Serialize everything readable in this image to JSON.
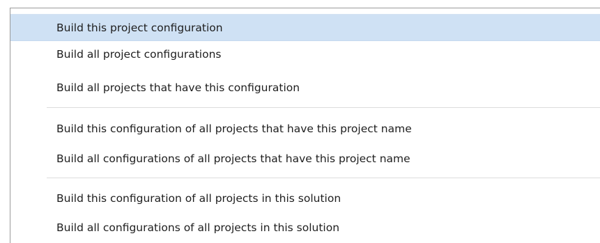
{
  "menu": {
    "groups": [
      {
        "items": [
          {
            "label": "Build this project configuration",
            "selected": true
          },
          {
            "label": "Build all project configurations",
            "selected": false
          },
          {
            "label": "Build all projects that have this configuration",
            "selected": false
          }
        ]
      },
      {
        "items": [
          {
            "label": "Build this configuration of all projects that have this project name",
            "selected": false
          },
          {
            "label": "Build all configurations of all projects that have this project name",
            "selected": false
          }
        ]
      },
      {
        "items": [
          {
            "label": "Build this configuration of all projects in this solution",
            "selected": false
          },
          {
            "label": "Build all configurations of all projects in this solution",
            "selected": false
          }
        ]
      }
    ]
  },
  "colors": {
    "selected_background": "#cfe1f4",
    "menu_border": "#9a9a9a",
    "separator": "#dcdcdc",
    "text": "#1e1e1e"
  }
}
